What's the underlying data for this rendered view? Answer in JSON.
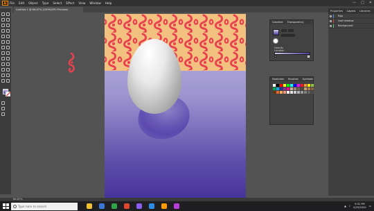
{
  "app": {
    "logo_text": "Ai",
    "menu": [
      "File",
      "Edit",
      "Object",
      "Type",
      "Select",
      "Effect",
      "View",
      "Window",
      "Help"
    ],
    "window_controls": [
      "—",
      "□",
      "✕"
    ]
  },
  "document": {
    "tab_title": "Untitled-1 @ 66.67% (CMYK/GPU Preview)"
  },
  "properties_panel": {
    "tabs": [
      "Gradient",
      "Transparency"
    ],
    "angle_label": "Opacity",
    "location_label": "Location"
  },
  "swatches_panel": {
    "tabs": [
      "Swatches",
      "Brushes",
      "Symbols"
    ],
    "colors": [
      "#ffffff",
      "#000000",
      "#ff0000",
      "#ffff00",
      "#00ff00",
      "#00ffff",
      "#0000ff",
      "#ff00ff",
      "#ed1c24",
      "#f7941d",
      "#fff200",
      "#8dc63f",
      "#00a651",
      "#00aeef",
      "#2e3192",
      "#92278f",
      "#ec008c",
      "#c7b299",
      "#998675",
      "#736357",
      "#534741",
      "#c69c6d",
      "#a67c52",
      "#8c6239",
      "#603913",
      "#f26522",
      "#fbaf5d",
      "#f7977a",
      "#ffffff",
      "#e6e6e6",
      "#cccccc",
      "#b3b3b3",
      "#999999",
      "#808080",
      "#666666",
      "#4d4d4d"
    ]
  },
  "layers_panel": {
    "tabs": [
      "Properties",
      "Layers",
      "Libraries"
    ],
    "active_tab": "Layers",
    "rows": [
      {
        "name": "Egg",
        "color": "#4f8ef7"
      },
      {
        "name": "Leaf shadow",
        "color": "#e84a4a"
      },
      {
        "name": "Background",
        "color": "#4fd36a"
      }
    ]
  },
  "status": {
    "zoom": "66.67%"
  },
  "taskbar": {
    "search_placeholder": "Type here to search",
    "time": "9:31 PM",
    "date": "5/25/2020",
    "app_colors": [
      "#f0c030",
      "#3a78d8",
      "#2fa24a",
      "#e0452e",
      "#8a5cf0",
      "#2b8de8",
      "#ff9a00",
      "#b93cd8"
    ]
  },
  "artwork": {
    "pattern_color_bg": "#f2c07f",
    "pattern_color_fg": "#e8414f",
    "egg_color": "#d9d9d9",
    "background_top": "#c4c0e3",
    "background_bottom": "#47349a"
  }
}
